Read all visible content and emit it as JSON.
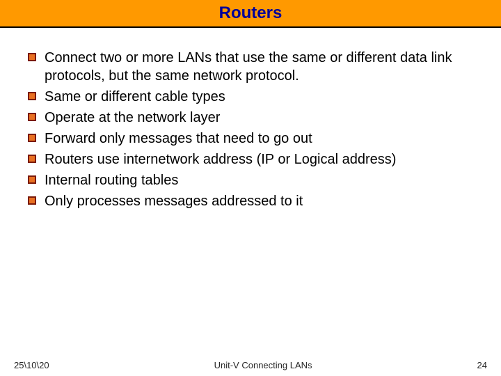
{
  "title": "Routers",
  "bullets": [
    "Connect two or more LANs that use the same or different data link protocols, but the same network protocol.",
    "Same or different cable types",
    "Operate at the network layer",
    "Forward only messages that need to go out",
    "Routers use internetwork address (IP or Logical address)",
    "Internal routing tables",
    "Only processes messages addressed to it"
  ],
  "footer": {
    "date": "25\\10\\20",
    "unit": "Unit-V Connecting LANs",
    "page": "24"
  }
}
